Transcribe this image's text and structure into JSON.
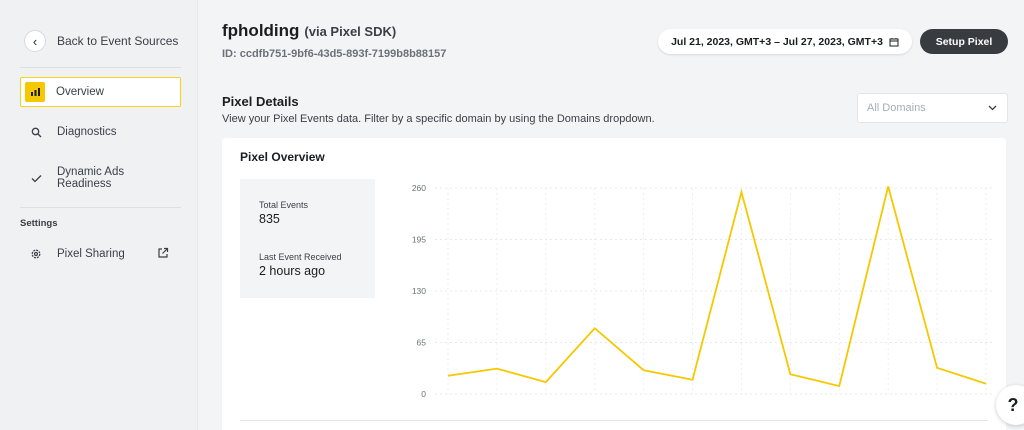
{
  "sidebar": {
    "back_label": "Back to Event Sources",
    "items": [
      {
        "label": "Overview",
        "icon": "bar-chart-icon"
      },
      {
        "label": "Diagnostics",
        "icon": "search-icon"
      },
      {
        "label": "Dynamic Ads Readiness",
        "icon": "check-icon"
      }
    ],
    "settings_label": "Settings",
    "settings_items": [
      {
        "label": "Pixel Sharing",
        "icon": "gear-icon"
      }
    ]
  },
  "header": {
    "name": "fpholding",
    "via": "(via Pixel SDK)",
    "pixel_id": "ID: ccdfb751-9bf6-43d5-893f-7199b8b88157",
    "date_range": "Jul 21, 2023, GMT+3 – Jul 27, 2023, GMT+3",
    "setup_label": "Setup Pixel"
  },
  "details": {
    "title": "Pixel Details",
    "subtitle": "View your Pixel Events data. Filter by a specific domain by using the Domains dropdown.",
    "domains_placeholder": "All Domains"
  },
  "overview": {
    "title": "Pixel Overview",
    "total_events_label": "Total Events",
    "total_events_value": "835",
    "last_event_label": "Last Event Received",
    "last_event_value": "2 hours ago"
  },
  "chart_data": {
    "type": "line",
    "x": [
      0,
      1,
      2,
      3,
      4,
      5,
      6,
      7,
      8,
      9,
      10,
      11
    ],
    "values": [
      23,
      32,
      15,
      83,
      30,
      18,
      255,
      25,
      10,
      262,
      33,
      13
    ],
    "ylim": [
      0,
      260
    ],
    "yticks": [
      0,
      65,
      130,
      195,
      260
    ],
    "grid": true,
    "color": "#f5c800"
  },
  "colors": {
    "accent": "#f5c800",
    "dark_button": "#383c41"
  }
}
